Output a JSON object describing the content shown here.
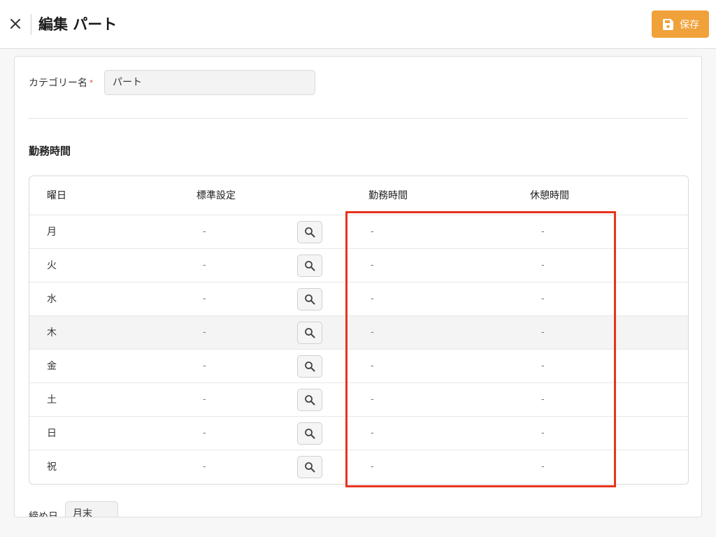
{
  "header": {
    "title": "編集 パート",
    "save_label": "保存",
    "accent_color": "#f0a13a"
  },
  "form": {
    "category_label": "カテゴリー名",
    "required_mark": "*",
    "category_value": "パート"
  },
  "work_section": {
    "title": "勤務時間",
    "columns": [
      "曜日",
      "標準設定",
      "勤務時間",
      "休憩時間"
    ],
    "rows": [
      {
        "day": "月",
        "standard": "-",
        "work": "-",
        "break": "-"
      },
      {
        "day": "火",
        "standard": "-",
        "work": "-",
        "break": "-"
      },
      {
        "day": "水",
        "standard": "-",
        "work": "-",
        "break": "-"
      },
      {
        "day": "木",
        "standard": "-",
        "work": "-",
        "break": "-"
      },
      {
        "day": "金",
        "standard": "-",
        "work": "-",
        "break": "-"
      },
      {
        "day": "土",
        "standard": "-",
        "work": "-",
        "break": "-"
      },
      {
        "day": "日",
        "standard": "-",
        "work": "-",
        "break": "-"
      },
      {
        "day": "祝",
        "standard": "-",
        "work": "-",
        "break": "-"
      }
    ],
    "highlighted_row_index": 3,
    "annotation_color": "#e8331c"
  },
  "bottom": {
    "label": "締め日",
    "value": "月末"
  }
}
